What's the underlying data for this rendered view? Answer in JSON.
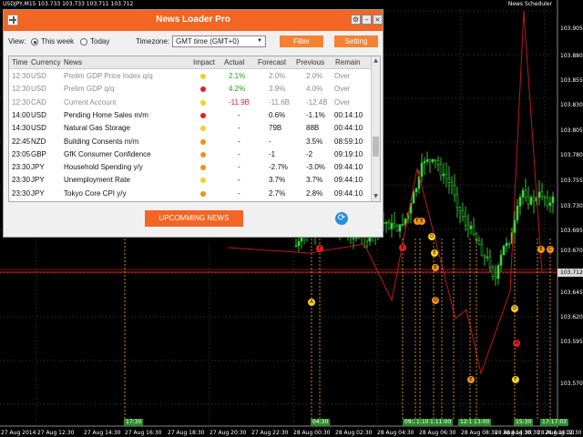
{
  "chart": {
    "symbol_info": "USDJPY,M15  103.733 103.733 103.711 103.712",
    "scheduler_label": "News Scheduler",
    "current_price": "103.712",
    "price_labels": [
      "103.905",
      "103.880",
      "103.855",
      "103.830",
      "103.805",
      "103.780",
      "103.755",
      "103.730",
      "103.695",
      "103.670",
      "103.645",
      "103.620",
      "103.595",
      "103.570"
    ],
    "time_labels": [
      "27 Aug 2014",
      "27 Aug 12:30",
      "27 Aug 14:30",
      "27 Aug 16:30",
      "27 Aug 18:30",
      "27 Aug 20:30",
      "27 Aug 22:30",
      "28 Aug 00:30",
      "28 Aug 02:30",
      "28 Aug 04:30",
      "28 Aug 06:30",
      "28 Aug 08:30",
      "28 Aug 10:30",
      "28 Aug 12:30",
      "28 Aug 14:30",
      "28 Aug 16:30"
    ],
    "time_tags": [
      "17:30",
      "04:30",
      "09:25",
      "1:10",
      "1:11:00",
      "12:15:00",
      "13:00",
      "15:30",
      "17:17:03"
    ],
    "event_markers": [
      {
        "letter": "A",
        "color": "#f5d020"
      },
      {
        "letter": "F",
        "color": "#e02020"
      },
      {
        "letter": "E",
        "color": "#e02020"
      },
      {
        "letter": "F",
        "color": "#f0901a"
      },
      {
        "letter": "E",
        "color": "#f0901a"
      },
      {
        "letter": "D",
        "color": "#f5d020"
      },
      {
        "letter": "E",
        "color": "#f5d020"
      },
      {
        "letter": "E",
        "color": "#f0901a"
      },
      {
        "letter": "D",
        "color": "#f0901a"
      },
      {
        "letter": "E",
        "color": "#f0901a"
      },
      {
        "letter": "D",
        "color": "#f5d020"
      },
      {
        "letter": "A",
        "color": "#e02020"
      },
      {
        "letter": "F",
        "color": "#f5d020"
      },
      {
        "letter": "E",
        "color": "#f0901a"
      },
      {
        "letter": "C",
        "color": "#f0901a"
      }
    ]
  },
  "panel": {
    "title": "News Loader Pro",
    "view_label": "View:",
    "this_week_label": "This week",
    "today_label": "Today",
    "timezone_label": "Timezone:",
    "timezone_value": "GMT time (GMT+0)",
    "filter_label": "Filter",
    "setting_label": "Setting",
    "upcoming_label": "UPCOMMING NEWS",
    "refresh_icon": "refresh-icon",
    "columns": [
      "Time",
      "Currency",
      "News",
      "Impact",
      "Actual",
      "Forecast",
      "Previous",
      "Remain"
    ],
    "impact_colors": {
      "low": "#f5d020",
      "medium": "#f0901a",
      "high": "#e02020"
    },
    "rows": [
      {
        "time": "12:30",
        "currency": "USD",
        "news": "Prelim GDP Price Index q/q",
        "impact": "low",
        "actual": "2.1%",
        "actual_color": "green",
        "forecast": "2.0%",
        "previous": "2.0%",
        "remain": "Over",
        "past": true
      },
      {
        "time": "12:30",
        "currency": "USD",
        "news": "Prelim GDP q/q",
        "impact": "high",
        "actual": "4.2%",
        "actual_color": "green",
        "forecast": "3.9%",
        "previous": "4.0%",
        "remain": "Over",
        "past": true
      },
      {
        "time": "12:30",
        "currency": "CAD",
        "news": "Current Account",
        "impact": "low",
        "actual": "-11.9B",
        "actual_color": "red",
        "forecast": "-11.6B",
        "previous": "-12.4B",
        "remain": "Over",
        "past": true
      },
      {
        "time": "14:00",
        "currency": "USD",
        "news": "Pending Home Sales m/m",
        "impact": "high",
        "actual": "-",
        "actual_color": "",
        "forecast": "0.6%",
        "previous": "-1.1%",
        "remain": "00:14:10",
        "past": false
      },
      {
        "time": "14:30",
        "currency": "USD",
        "news": "Natural Gas Storage",
        "impact": "low",
        "actual": "-",
        "actual_color": "",
        "forecast": "79B",
        "previous": "88B",
        "remain": "00:44:10",
        "past": false
      },
      {
        "time": "22:45",
        "currency": "NZD",
        "news": "Building Consents m/m",
        "impact": "medium",
        "actual": "-",
        "actual_color": "",
        "forecast": "-",
        "previous": "3.5%",
        "remain": "08:59:10",
        "past": false
      },
      {
        "time": "23:05",
        "currency": "GBP",
        "news": "GfK Consumer Confidence",
        "impact": "medium",
        "actual": "-",
        "actual_color": "",
        "forecast": "-1",
        "previous": "-2",
        "remain": "09:19:10",
        "past": false
      },
      {
        "time": "23:30",
        "currency": "JPY",
        "news": "Household Spending y/y",
        "impact": "medium",
        "actual": "-",
        "actual_color": "",
        "forecast": "-2.7%",
        "previous": "-3.0%",
        "remain": "09:44:10",
        "past": false
      },
      {
        "time": "23:30",
        "currency": "JPY",
        "news": "Unemployment Rate",
        "impact": "low",
        "actual": "-",
        "actual_color": "",
        "forecast": "3.7%",
        "previous": "3.7%",
        "remain": "09:44:10",
        "past": false
      },
      {
        "time": "23:30",
        "currency": "JPY",
        "news": "Tokyo Core CPI y/y",
        "impact": "medium",
        "actual": "-",
        "actual_color": "",
        "forecast": "2.7%",
        "previous": "2.8%",
        "remain": "09:44:10",
        "past": false
      }
    ]
  }
}
